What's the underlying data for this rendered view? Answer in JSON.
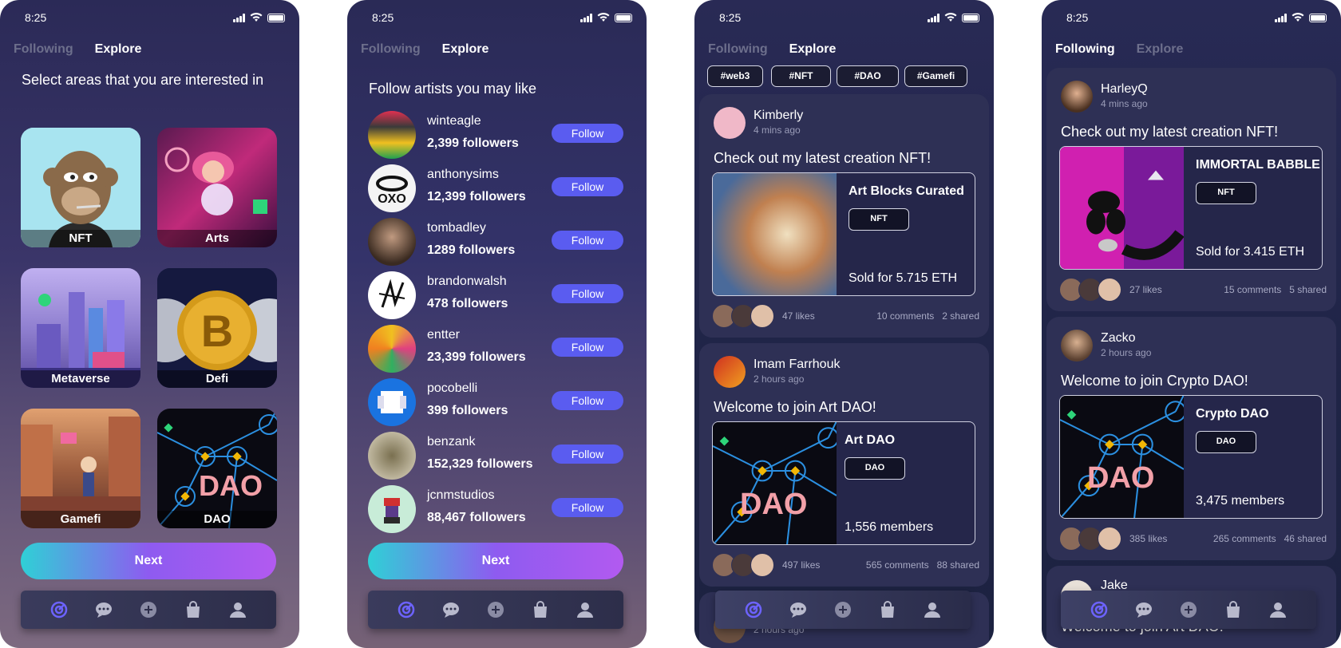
{
  "status": {
    "time": "8:25"
  },
  "tabs": {
    "following": "Following",
    "explore": "Explore"
  },
  "screen1": {
    "heading": "Select areas that you are interested in",
    "tiles": [
      "NFT",
      "Arts",
      "Metaverse",
      "Defi",
      "Gamefi",
      "DAO"
    ],
    "next": "Next"
  },
  "screen2": {
    "heading": "Follow artists you may like",
    "artists": [
      {
        "name": "winteagle",
        "followers": "2,399 followers"
      },
      {
        "name": "anthonysims",
        "followers": "12,399 followers"
      },
      {
        "name": "tombadley",
        "followers": "1289 followers"
      },
      {
        "name": "brandonwalsh",
        "followers": "478 followers"
      },
      {
        "name": "entter",
        "followers": "23,399 followers"
      },
      {
        "name": "pocobelli",
        "followers": "399 followers"
      },
      {
        "name": "benzank",
        "followers": "152,329 followers"
      },
      {
        "name": "jcnmstudios",
        "followers": "88,467 followers"
      }
    ],
    "follow_label": "Follow",
    "next": "Next"
  },
  "screen3": {
    "chips": [
      "#web3",
      "#NFT",
      "#DAO",
      "#Gamefi"
    ],
    "posts": [
      {
        "name": "Kimberly",
        "time": "4 mins ago",
        "text": "Check out my latest creation NFT!",
        "title": "Art Blocks Curated",
        "badge": "NFT",
        "footer": "Sold for 5.715 ETH",
        "likes": "47 likes",
        "comments": "10 comments",
        "shared": "2 shared"
      },
      {
        "name": "Imam Farrhouk",
        "time": "2 hours ago",
        "text": "Welcome to join Art DAO!",
        "title": "Art DAO",
        "badge": "DAO",
        "footer": "1,556 members",
        "likes": "497 likes",
        "comments": "565 comments",
        "shared": "88 shared"
      }
    ],
    "partial_time": "2 hours ago"
  },
  "screen4": {
    "posts": [
      {
        "name": "HarleyQ",
        "time": "4 mins ago",
        "text": "Check out my latest creation NFT!",
        "title": "IMMORTAL BABBLE",
        "badge": "NFT",
        "footer": "Sold for 3.415 ETH",
        "likes": "27 likes",
        "comments": "15 comments",
        "shared": "5 shared"
      },
      {
        "name": "Zacko",
        "time": "2 hours ago",
        "text": "Welcome to join Crypto DAO!",
        "title": "Crypto DAO",
        "badge": "DAO",
        "footer": "3,475 members",
        "likes": "385 likes",
        "comments": "265 comments",
        "shared": "46 shared"
      }
    ],
    "partial_name": "Jake",
    "partial_text": "Welcome to join Art DAO!"
  },
  "dao_word": "DAO",
  "colors": {
    "accent": "#5a5cf0",
    "gradient_start": "#2fd0d6",
    "gradient_end": "#b25af0",
    "active_nav": "#6d63ff"
  },
  "nav_icons": [
    "explore-icon",
    "chat-icon",
    "add-icon",
    "shop-icon",
    "profile-icon"
  ]
}
